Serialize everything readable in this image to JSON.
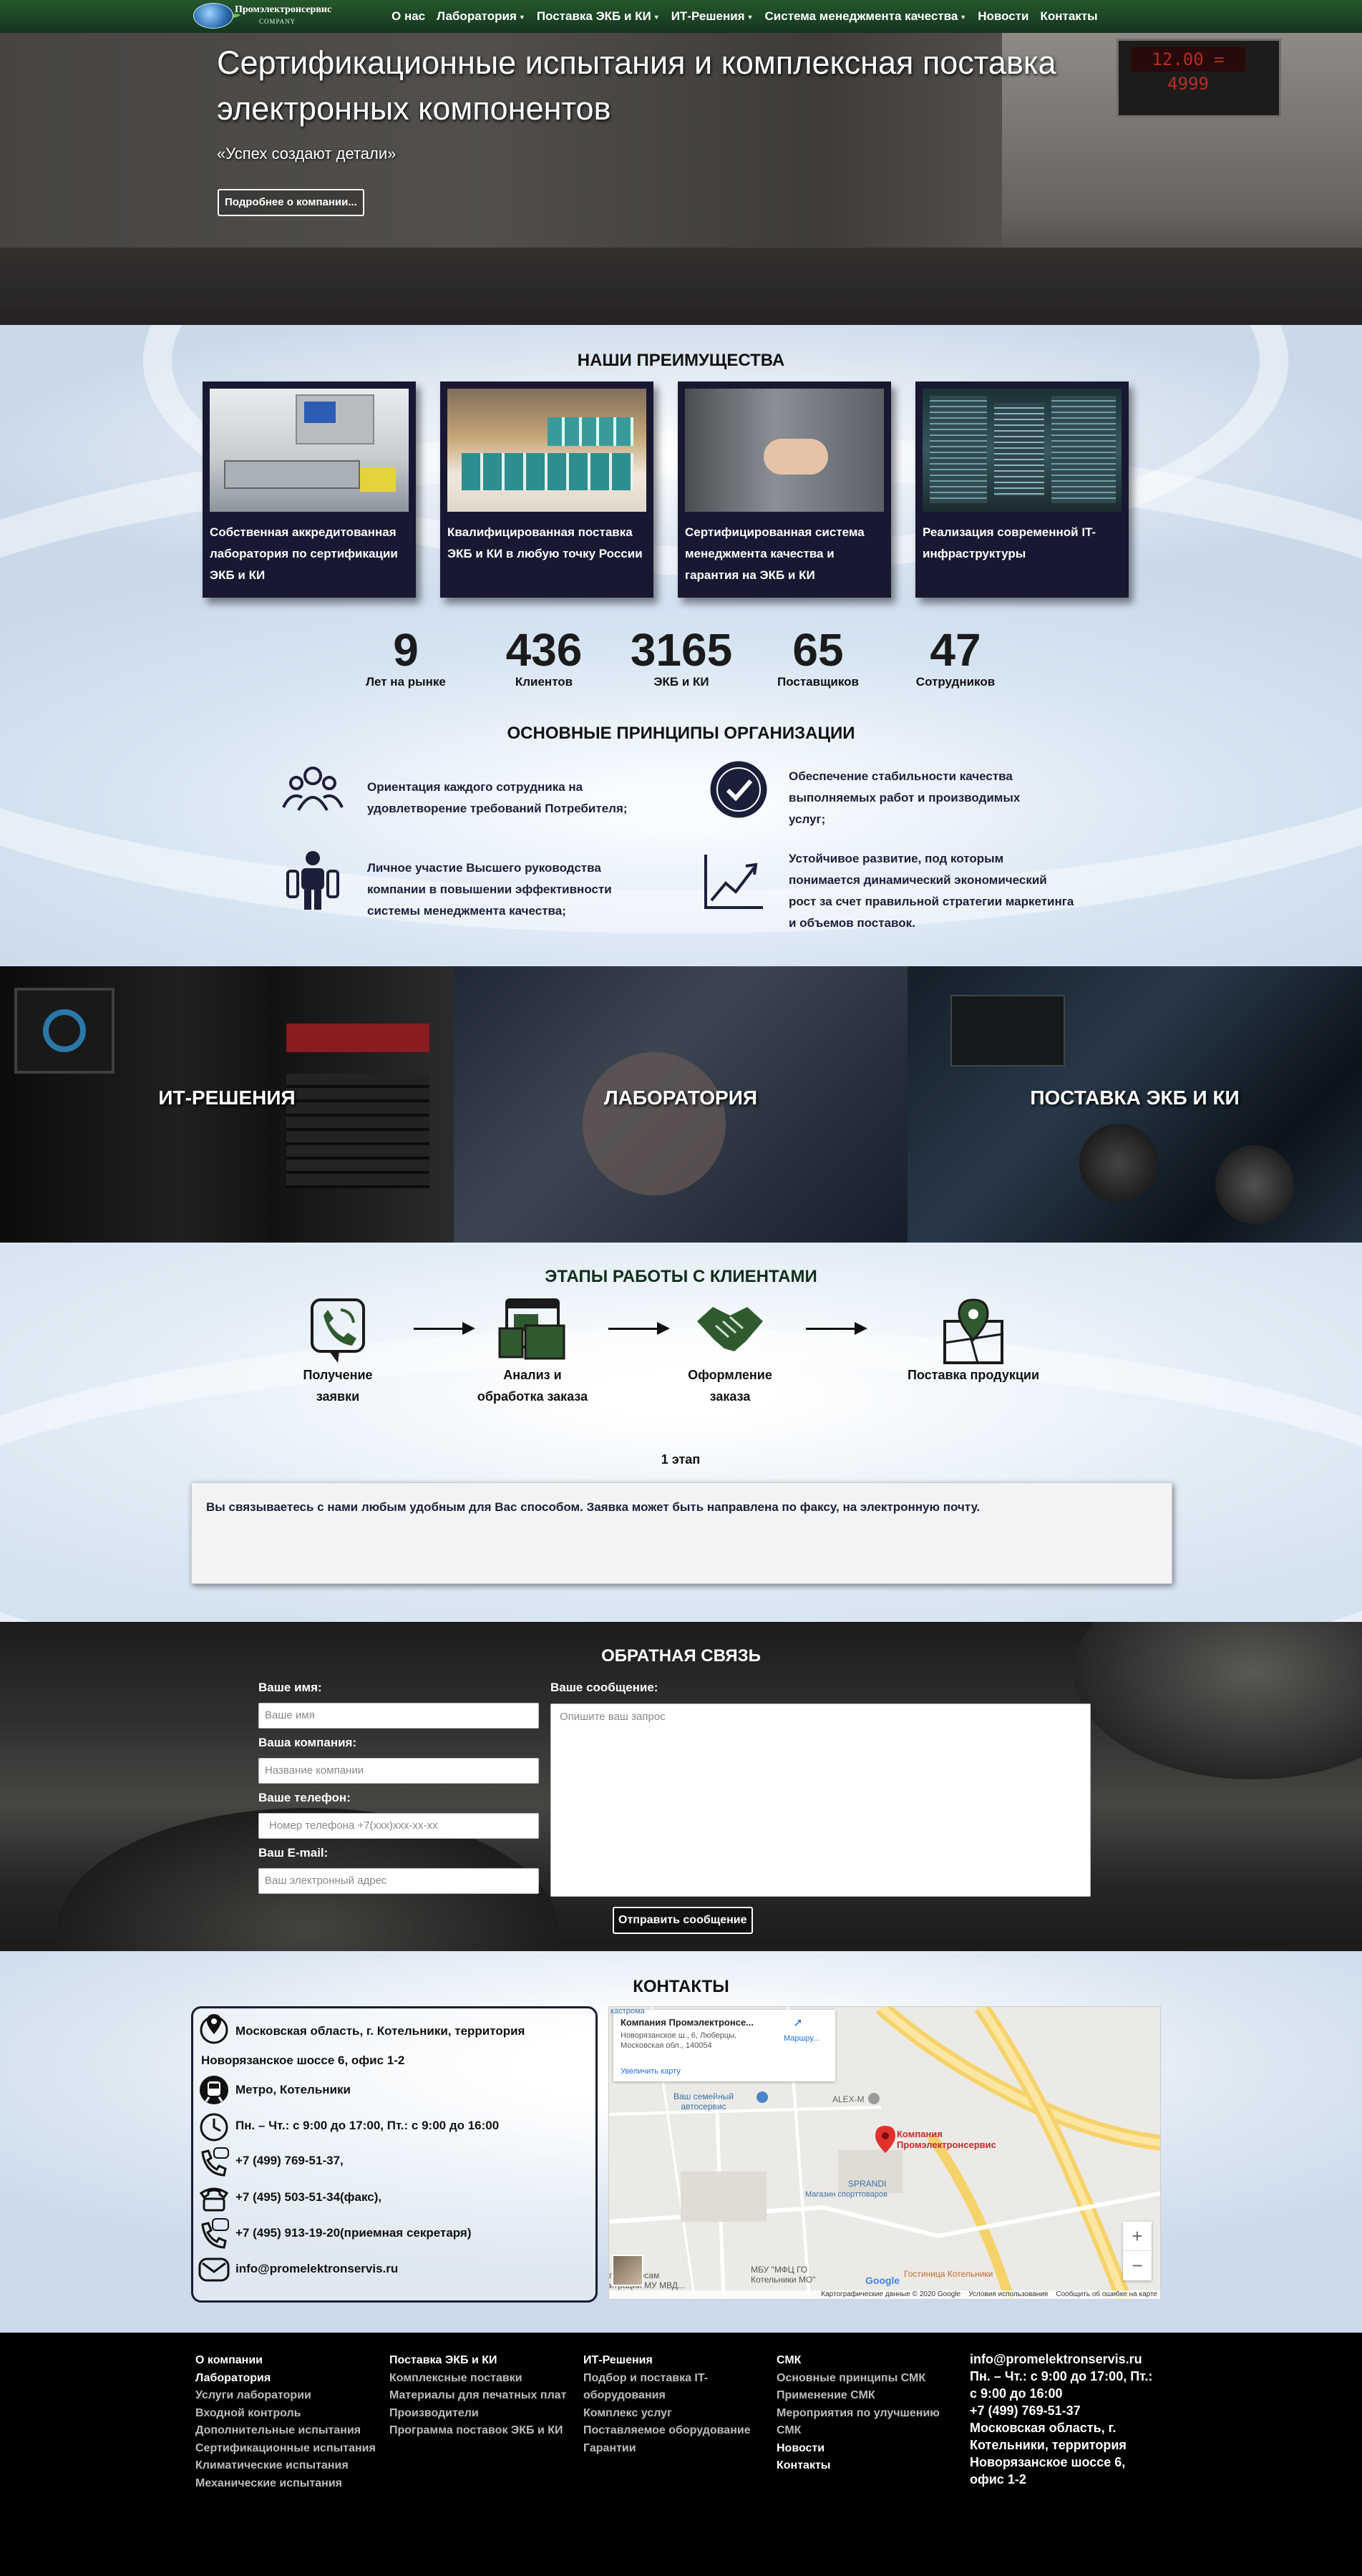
{
  "nav": {
    "logo_text": "Промэлектронсервис",
    "logo_sub": "COMPANY",
    "items": [
      {
        "label": "О нас",
        "dropdown": false
      },
      {
        "label": "Лаборатория",
        "dropdown": true
      },
      {
        "label": "Поставка ЭКБ и КИ",
        "dropdown": true
      },
      {
        "label": "ИТ-Решения",
        "dropdown": true
      },
      {
        "label": "Система менеджмента качества",
        "dropdown": true
      },
      {
        "label": "Новости",
        "dropdown": false
      },
      {
        "label": "Контакты",
        "dropdown": false
      }
    ]
  },
  "hero": {
    "title": "Сертификационные испытания и комплексная поставка электронных компонентов",
    "slogan": "«Успех создают детали»",
    "button": "Подробнее о компании...",
    "display": "12.00 = 4999"
  },
  "advantages": {
    "title": "НАШИ ПРЕИМУЩЕСТВА",
    "cards": [
      {
        "text": "Собственная аккредитованная лаборатория по сертификации ЭКБ и КИ"
      },
      {
        "text": "Квалифицированная поставка ЭКБ и КИ в любую точку России"
      },
      {
        "text": "Сертифицированная система менеджмента качества и гарантия на ЭКБ и КИ"
      },
      {
        "text": "Реализация современной IT-инфраструктуры"
      }
    ]
  },
  "stats": [
    {
      "value": "9",
      "label": "Лет на рынке"
    },
    {
      "value": "436",
      "label": "Клиентов"
    },
    {
      "value": "3165",
      "label": "ЭКБ и КИ"
    },
    {
      "value": "65",
      "label": "Поставщиков"
    },
    {
      "value": "47",
      "label": "Сотрудников"
    }
  ],
  "principles": {
    "title": "ОСНОВНЫЕ ПРИНЦИПЫ ОРГАНИЗАЦИИ",
    "items": [
      {
        "text": "Ориентация каждого сотрудника на удовлетворение требований Потребителя;",
        "icon": "people-group-icon"
      },
      {
        "text": "Обеспечение стабильности качества выполняемых работ и производимых услуг;",
        "icon": "check-circle-icon"
      },
      {
        "text": "Личное участие Высшего руководства компании в повышении эффективности системы менеджмента качества;",
        "icon": "leaders-icon"
      },
      {
        "text": "Устойчивое развитие, под которым понимается динамический экономический рост за счет правильной стратегии маркетинга и объемов поставок.",
        "icon": "growth-chart-icon"
      }
    ]
  },
  "tiles": [
    {
      "label": "ИТ-РЕШЕНИЯ"
    },
    {
      "label": "ЛАБОРАТОРИЯ"
    },
    {
      "label": "ПОСТАВКА ЭКБ И КИ"
    }
  ],
  "stages": {
    "title": "ЭТАПЫ РАБОТЫ С КЛИЕНТАМИ",
    "steps": [
      {
        "label": "Получение заявки",
        "icon": "phone-call-icon"
      },
      {
        "label": "Анализ и обработка заказа",
        "icon": "analysis-screens-icon"
      },
      {
        "label": "Оформление заказа",
        "icon": "handshake-icon"
      },
      {
        "label": "Поставка продукции",
        "icon": "map-pin-icon"
      }
    ],
    "current": "1 этап",
    "description": "Вы связываетесь с нами любым удобным для Вас способом. Заявка может быть направлена по факсу, на электронную почту."
  },
  "feedback": {
    "title": "ОБРАТНАЯ СВЯЗЬ",
    "name_label": "Ваше имя:",
    "name_placeholder": "Ваше имя",
    "company_label": "Ваша компания:",
    "company_placeholder": "Название компании",
    "phone_label": "Ваше телефон:",
    "phone_placeholder": "Номер телефона +7(xxx)xxx-xx-xx",
    "email_label": "Ваш E-mail:",
    "email_placeholder": "Ваш электронный адрес",
    "message_label": "Ваше сообщение:",
    "message_placeholder": "Опишите ваш запрос",
    "submit": "Отправить сообщение"
  },
  "contacts": {
    "title": "КОНТАКТЫ",
    "address_line1": "Московская область, г. Котельники, территория",
    "address_line2": "Новорязанское шоссе 6, офис 1-2",
    "metro": "Метро, Котельники",
    "hours": "Пн. – Чт.: с 9:00 до 17:00, Пт.: с 9:00 до 16:00",
    "phone1": "+7 (499) 769-51-37,",
    "phone2": "+7 (495) 503-51-34(факс),",
    "phone3": "+7 (495) 913-19-20(приемная секретаря)",
    "email": "info@promelektronservis.ru"
  },
  "map": {
    "place_name": "Компания Промэлектронсе...",
    "place_addr1": "Новорязанское ш., 6, Люберцы,",
    "place_addr2": "Московская обл., 140054",
    "route": "Маршру...",
    "enlarge": "Увеличить карту",
    "label_autoservice1": "Ваш семейный",
    "label_autoservice2": "автосервис",
    "label_alexm": "ALEX-M",
    "label_company1": "Компания",
    "label_company2": "Промэлектронсервис",
    "label_sprandi": "SPRANDI",
    "label_sport": "Магазин спорттоваров",
    "label_mfc1": "МБУ \"МФЦ ГО",
    "label_mfc2": "Котельники МО\"",
    "label_kotelniki": "Гостиница Котельники",
    "label_mu1": "по вопросам",
    "label_mu2": "итрации МУ МВД...",
    "label_top": "кастрома",
    "copyright": "Картографические данные © 2020 Google",
    "terms": "Условия использования",
    "report": "Сообщить об ошибке на карте",
    "zoom_in": "+",
    "zoom_out": "−",
    "google": "Google"
  },
  "footer": {
    "col1": [
      {
        "label": "О компании",
        "strong": true
      },
      {
        "label": "Лаборатория",
        "strong": true
      },
      {
        "label": "Услуги лаборатории",
        "strong": false
      },
      {
        "label": "Входной контроль",
        "strong": false
      },
      {
        "label": "Дополнительные испытания",
        "strong": false
      },
      {
        "label": "Сертификационные испытания",
        "strong": false
      },
      {
        "label": "Климатические испытания",
        "strong": false
      },
      {
        "label": "Механические испытания",
        "strong": false
      }
    ],
    "col2": [
      {
        "label": "Поставка ЭКБ и КИ",
        "strong": true
      },
      {
        "label": "Комплексные поставки",
        "strong": false
      },
      {
        "label": "Материалы для печатных плат",
        "strong": false
      },
      {
        "label": "Производители",
        "strong": false
      },
      {
        "label": "Программа поставок ЭКБ и КИ",
        "strong": false
      }
    ],
    "col3": [
      {
        "label": "ИТ-Решения",
        "strong": true
      },
      {
        "label": "Подбор и поставка IT-",
        "strong": false
      },
      {
        "label": "оборудования",
        "strong": false
      },
      {
        "label": "Комплекс услуг",
        "strong": false
      },
      {
        "label": "Поставляемое оборудование",
        "strong": false
      },
      {
        "label": "Гарантии",
        "strong": false
      }
    ],
    "col4": [
      {
        "label": "СМК",
        "strong": true
      },
      {
        "label": "Основные принципы СМК",
        "strong": false
      },
      {
        "label": "Применение СМК",
        "strong": false
      },
      {
        "label": "Мероприятия по улучшению",
        "strong": false
      },
      {
        "label": "СМК",
        "strong": false
      },
      {
        "label": "Новости",
        "strong": true
      },
      {
        "label": "Контакты",
        "strong": true
      }
    ],
    "contact_lines": [
      "info@promelektronservis.ru",
      "Пн. – Чт.: с 9:00 до 17:00, Пт.:",
      "с 9:00 до 16:00",
      "+7 (499) 769-51-37",
      "Московская область, г.",
      "Котельники, территория",
      "Новорязанское шоссе 6,",
      "офис 1-2"
    ]
  }
}
